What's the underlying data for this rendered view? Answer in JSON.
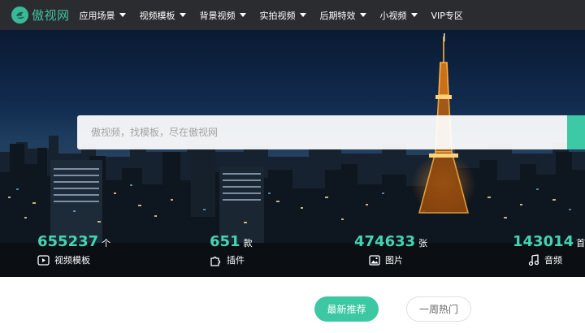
{
  "brand": {
    "name": "傲视网",
    "accent": "#3dc39f"
  },
  "nav": {
    "items": [
      {
        "label": "应用场景",
        "has_dropdown": true
      },
      {
        "label": "视频模板",
        "has_dropdown": true
      },
      {
        "label": "背景视频",
        "has_dropdown": true
      },
      {
        "label": "实拍视频",
        "has_dropdown": true
      },
      {
        "label": "后期特效",
        "has_dropdown": true
      },
      {
        "label": "小视频",
        "has_dropdown": true
      },
      {
        "label": "VIP专区",
        "has_dropdown": false
      }
    ]
  },
  "search": {
    "placeholder": "傲视频，找模板，尽在傲视网",
    "value": ""
  },
  "stats": [
    {
      "count": "655237",
      "unit": "个",
      "label": "视频模板",
      "icon": "video-play-icon"
    },
    {
      "count": "651",
      "unit": "款",
      "label": "插件",
      "icon": "puzzle-icon"
    },
    {
      "count": "474633",
      "unit": "张",
      "label": "图片",
      "icon": "image-icon"
    },
    {
      "count": "143014",
      "unit": "首",
      "label": "音频",
      "icon": "music-note-icon"
    }
  ],
  "tabs": [
    {
      "label": "最新推荐",
      "active": true
    },
    {
      "label": "一周热门",
      "active": false
    }
  ]
}
